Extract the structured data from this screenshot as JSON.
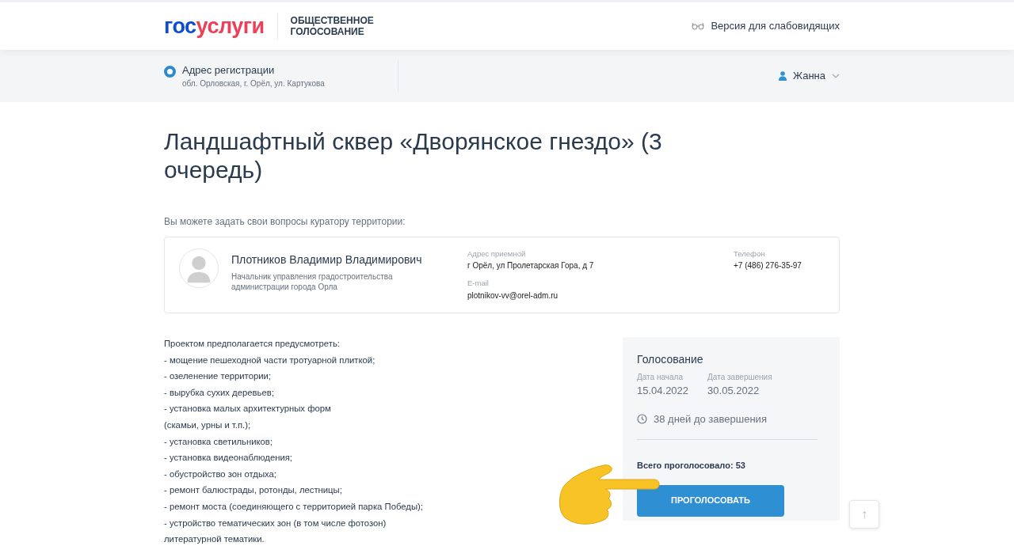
{
  "header": {
    "logo": {
      "part_1": "гос",
      "part_2": "услуги"
    },
    "service_title": "ОБЩЕСТВЕННОЕ ГОЛОСОВАНИЕ",
    "accessibility_link": "Версия для слабовидящих"
  },
  "subheader": {
    "address_label": "Адрес регистрации",
    "address": "обл. Орловская, г. Орёл, ул. Картукова",
    "address_selected": true,
    "user_name": "Жанна"
  },
  "title": "Ландшафтный сквер «Дворянское гнездо» (3 очередь)",
  "curator_intro": "Вы можете задать свои вопросы куратору территории:",
  "curator": {
    "name": "Плотников Владимир Владимирович",
    "position": "Начальник управления градостроительства администрации города Орла",
    "fields": [
      {
        "label": "Адрес приемной",
        "value": "г Орёл, ул Пролетарская Гора, д 7"
      },
      {
        "label": "Телефон",
        "value": "+7 (486) 276-35-97"
      },
      {
        "label": "E-mail",
        "value": "plotnikov-vv@orel-adm.ru"
      }
    ]
  },
  "description": [
    "Проектом предполагается предусмотреть:",
    "- мощение пешеходной части тротуарной плиткой;",
    "- озеленение территории;",
    "- вырубка сухих деревьев;",
    "- установка малых архитектурных форм",
    "(скамьи, урны и т.п.);",
    "- установка светильников;",
    "- установка видеонаблюдения;",
    "- обустройство зон отдыха;",
    "- ремонт балюстрады, ротонды, лестницы;",
    "- ремонт моста (соединяющего с территорией парка Победы);",
    "- устройство тематических зон (в том числе фотозон)",
    "литературной тематики."
  ],
  "voting": {
    "title": "Голосование",
    "start_label": "Дата начала",
    "start_date": "15.04.2022",
    "end_label": "Дата завершения",
    "end_date": "30.05.2022",
    "remaining": "38 дней до завершения",
    "total": "Всего проголосовало: 53",
    "button": "ПРОГОЛОСОВАТЬ"
  },
  "scroll_top_button": "↑"
}
